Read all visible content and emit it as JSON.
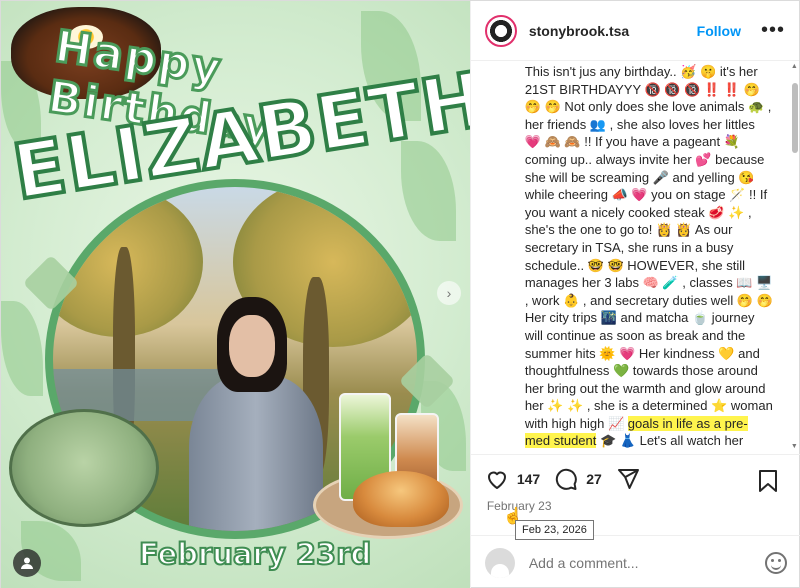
{
  "post_image": {
    "title_line1": "Happy Birthday",
    "title_line2": "ELIZABETH!",
    "date_banner": "February 23rd",
    "user_tag_icon": "person-icon",
    "next_icon": "chevron-right-icon"
  },
  "header": {
    "username": "stonybrook.tsa",
    "follow_label": "Follow",
    "more_icon": "more-horizontal-icon"
  },
  "caption": {
    "text": "This isn't jus any birthday.. 🥳 🤫 it's her 21ST BIRTHDAYYY 🔞 🔞 🔞 ‼️ ‼️ 🤭 🤭 🤭 Not only does she love animals 🐢 , her friends 👥 , she also loves her littles 💗 🙈 🙈 !! If you have a pageant 💐 coming up.. always invite her 💕 because she will be screaming 🎤 and yelling 😘 while cheering 📣 💗 you on stage 🪄 !! If you want a nicely cooked steak 🥩 ✨ , she's the one to go to! 👸 👸 As our secretary in TSA, she runs in a busy schedule.. 🤓 🤓 HOWEVER, she still manages her 3 labs 🧠 🧪 , classes 📖 🖥️ , work 👶 , and secretary duties well 🤭 🤭 Her city trips 🌃 and matcha 🍵 journey will continue as soon as break and the summer hits 🌞 💗 Her kindness 💛 and thoughtfulness 💚 towards those around her bring out the warmth and glow around her ✨ ✨ , she is a determined ⭐ woman with high high 📈",
    "highlight": "goals in life as a pre-med student",
    "tail": " 🎓 👗 Let's all watch her"
  },
  "actions": {
    "like_icon": "heart-icon",
    "like_count": "147",
    "comment_icon": "comment-icon",
    "comment_count": "27",
    "share_icon": "send-icon",
    "save_icon": "bookmark-icon"
  },
  "post_date": "February 23",
  "tooltip": "Feb 23, 2026",
  "comment": {
    "placeholder": "Add a comment...",
    "emoji_icon": "smiley-icon"
  }
}
